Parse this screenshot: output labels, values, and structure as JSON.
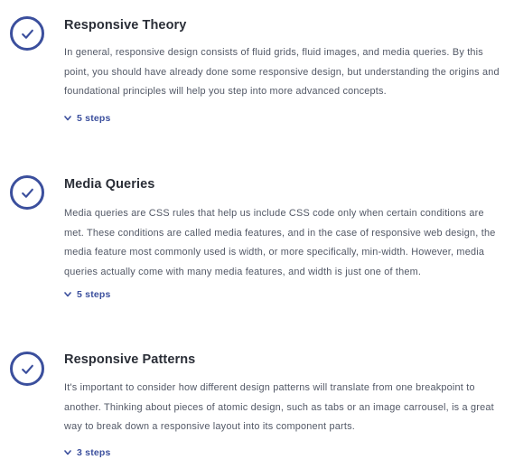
{
  "lessons": [
    {
      "title": "Responsive Theory",
      "description": "In general, responsive design consists of fluid grids, fluid images, and media queries. By this point, you should have already done some responsive design, but understanding the origins and foundational principles will help you step into more advanced concepts.",
      "steps_label": "5 steps",
      "status_icon": "check-circle-icon"
    },
    {
      "title": "Media Queries",
      "description": "Media queries are CSS rules that help us include CSS code only when certain conditions are met. These conditions are called media features, and in the case of responsive web design, the media feature most commonly used is width, or more specifically, min-width. However, media queries actually come with many media features, and width is just one of them.",
      "steps_label": "5 steps",
      "status_icon": "check-circle-icon"
    },
    {
      "title": "Responsive Patterns",
      "description": "It's important to consider how different design patterns will translate from one breakpoint to another. Thinking about pieces of atomic design, such as tabs or an image carrousel, is a great way to break down a responsive layout into its component parts.",
      "steps_label": "3 steps",
      "status_icon": "check-circle-icon"
    }
  ],
  "colors": {
    "accent": "#3b4f9d",
    "title": "#2a2e37",
    "body_text": "#525866"
  }
}
